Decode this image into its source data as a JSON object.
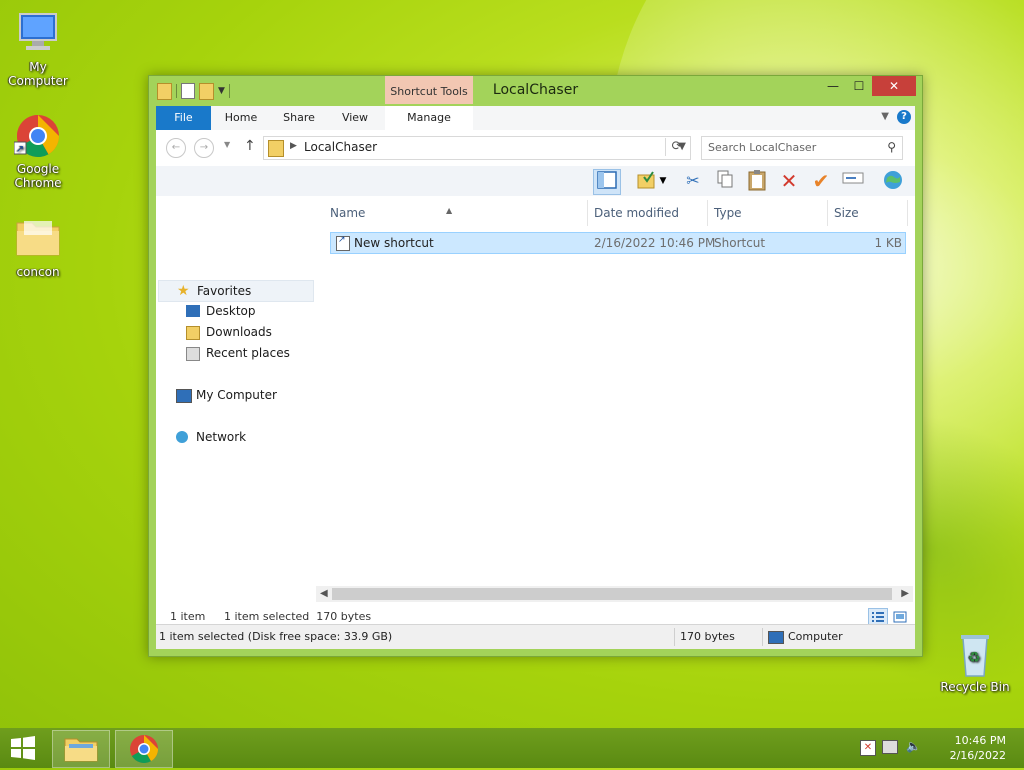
{
  "desktop": {
    "icons": [
      {
        "label": "My Computer"
      },
      {
        "label": "Google Chrome"
      },
      {
        "label": "concon"
      },
      {
        "label": "Recycle Bin"
      }
    ]
  },
  "window": {
    "title": "LocalChaser",
    "context_tab_group": "Shortcut Tools",
    "ribbon_tabs": [
      "File",
      "Home",
      "Share",
      "View",
      "Manage"
    ],
    "controls": {
      "minimize": "—",
      "maximize": "☐",
      "close": "✕"
    }
  },
  "address_bar": {
    "path": "LocalChaser",
    "search_placeholder": "Search LocalChaser"
  },
  "nav_pane": {
    "favorites": "Favorites",
    "favorites_items": [
      "Desktop",
      "Downloads",
      "Recent places"
    ],
    "computer": "My Computer",
    "network": "Network"
  },
  "columns": [
    "Name",
    "Date modified",
    "Type",
    "Size"
  ],
  "files": [
    {
      "name": "New shortcut",
      "date": "2/16/2022 10:46 PM",
      "type": "Shortcut",
      "size": "1 KB"
    }
  ],
  "status": {
    "count": "1 item",
    "selected": "1 item selected  170 bytes",
    "details": "1 item selected (Disk free space: 33.9 GB)",
    "size": "170 bytes",
    "location": "Computer"
  },
  "taskbar": {
    "time": "10:46 PM",
    "date": "2/16/2022"
  },
  "colors": {
    "accent": "#1979ca",
    "window_frame": "#a3d35a",
    "context_tab": "#f2c7b2",
    "selection": "#cce8ff",
    "close_button": "#c7403a"
  }
}
